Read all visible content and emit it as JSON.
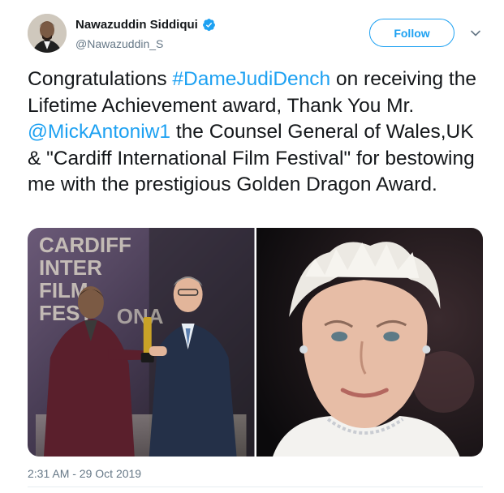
{
  "author": {
    "name": "Nawazuddin Siddiqui",
    "handle": "@Nawazuddin_S",
    "verified_icon": "verified-badge-icon",
    "avatar_icon": "profile-avatar"
  },
  "follow_label": "Follow",
  "menu_icon": "chevron-down-icon",
  "tweet": {
    "t1": "Congratulations ",
    "hashtag": "#DameJudiDench",
    "t2": " on receiving the Lifetime Achievement award, Thank You Mr. ",
    "mention": "@MickAntoniw1",
    "t3": " the Counsel General of Wales,UK & \"Cardiff International Film Festival\" for bestowing me with the prestigious Golden Dragon Award."
  },
  "media": [
    {
      "name": "award-ceremony-photo",
      "backdrop_text": [
        "CARDIFF",
        "INTER",
        "FILM",
        "FEST",
        "ONA"
      ]
    },
    {
      "name": "judi-dench-portrait-photo"
    }
  ],
  "timestamp": "2:31 AM - 29 Oct 2019",
  "colors": {
    "accent": "#1da1f2",
    "text": "#14171a",
    "secondary": "#657786",
    "divider": "#e6ecf0"
  }
}
